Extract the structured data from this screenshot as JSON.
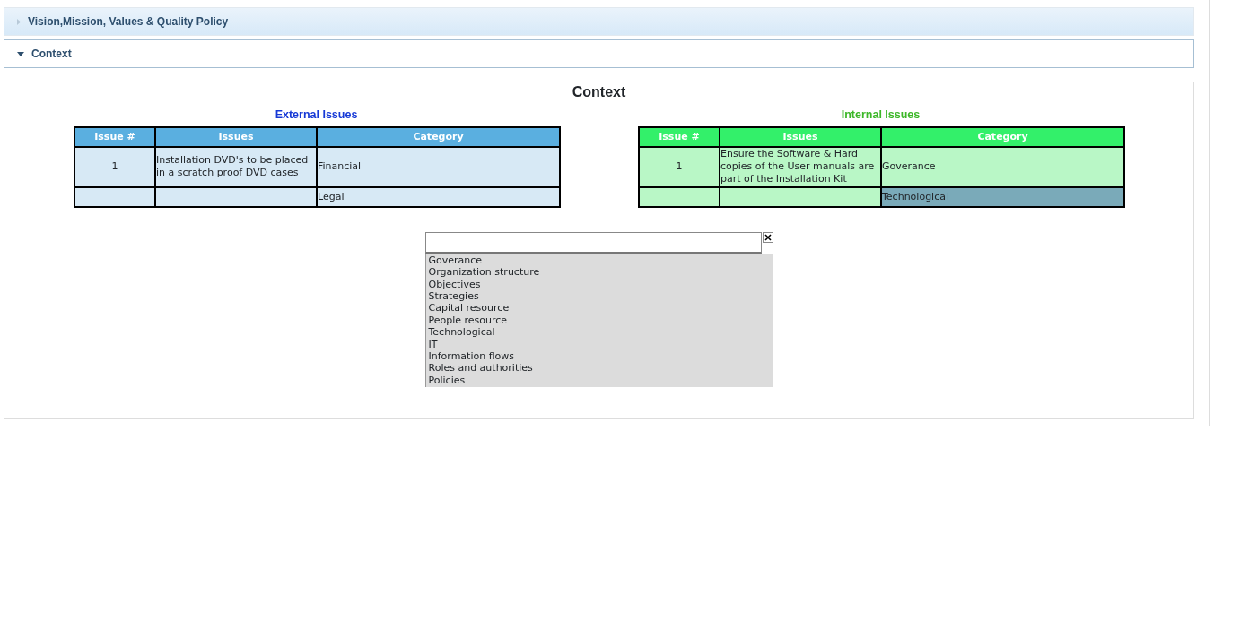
{
  "sections": [
    {
      "title": "Vision,Mission, Values & Quality Policy",
      "expanded": false
    },
    {
      "title": "Context",
      "expanded": true
    }
  ],
  "context": {
    "heading": "Context",
    "tables": [
      {
        "title": "External Issues",
        "kind": "external",
        "columns": [
          "Issue #",
          "Issues",
          "Category"
        ],
        "rows": [
          {
            "cells": [
              "1",
              "Installation DVD's to be placed in a scratch proof DVD cases",
              "Financial"
            ],
            "selected": false
          },
          {
            "cells": [
              "",
              "",
              "Legal"
            ],
            "selected": false
          }
        ]
      },
      {
        "title": "Internal Issues",
        "kind": "internal",
        "columns": [
          "Issue #",
          "Issues",
          "Category"
        ],
        "rows": [
          {
            "cells": [
              "1",
              "Ensure the Software & Hard copies of the User manuals are part of the Installation Kit",
              "Goverance"
            ],
            "selected": false
          },
          {
            "cells": [
              "",
              "",
              "Technological"
            ],
            "selected": true
          }
        ]
      }
    ],
    "dropdown": {
      "options": [
        "Goverance",
        "Organization structure",
        "Objectives",
        "Strategies",
        "Capital resource",
        "People resource",
        "Technological",
        "IT",
        "Information flows",
        "Roles and authorities",
        "Policies"
      ]
    }
  }
}
